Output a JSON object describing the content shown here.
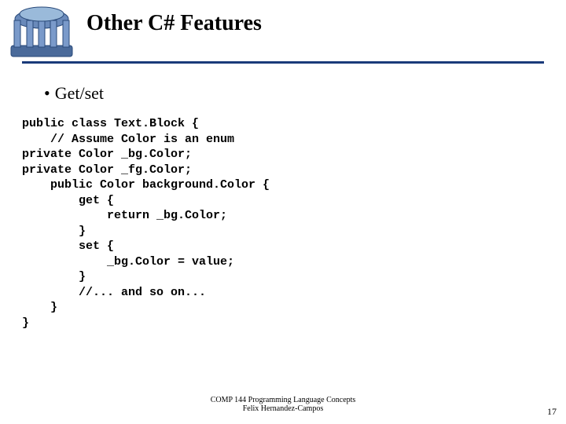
{
  "title": "Other C# Features",
  "bullet": "Get/set",
  "code": "public class Text.Block {\n    // Assume Color is an enum\nprivate Color _bg.Color;\nprivate Color _fg.Color;\n    public Color background.Color {\n        get {\n            return _bg.Color;\n        }\n        set {\n            _bg.Color = value;\n        }\n        //... and so on...\n    }\n}",
  "footer_line1": "COMP 144 Programming Language Concepts",
  "footer_line2": "Felix Hernandez-Campos",
  "page": "17"
}
